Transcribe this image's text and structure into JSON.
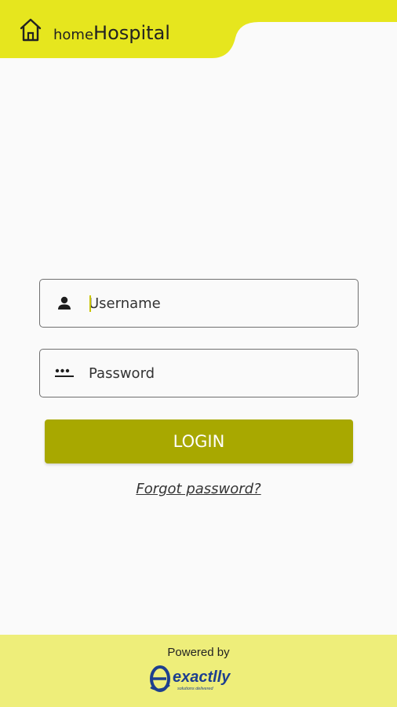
{
  "app": {
    "logo_prefix": "home",
    "logo_main": "Hospital"
  },
  "login": {
    "username_placeholder": "Username",
    "password_placeholder": "Password",
    "login_label": "LOGIN",
    "forgot_label": "Forgot password?"
  },
  "footer": {
    "powered_by": "Powered by",
    "brand_name": "exactlly",
    "brand_tagline": "solutions delivered"
  },
  "colors": {
    "header": "#e6e61e",
    "button": "#a8a800",
    "footer": "#eeee7a",
    "brand_blue": "#1d3f8f"
  },
  "icons": {
    "header": "home-icon",
    "username": "person-icon",
    "password": "password-dots-icon"
  }
}
